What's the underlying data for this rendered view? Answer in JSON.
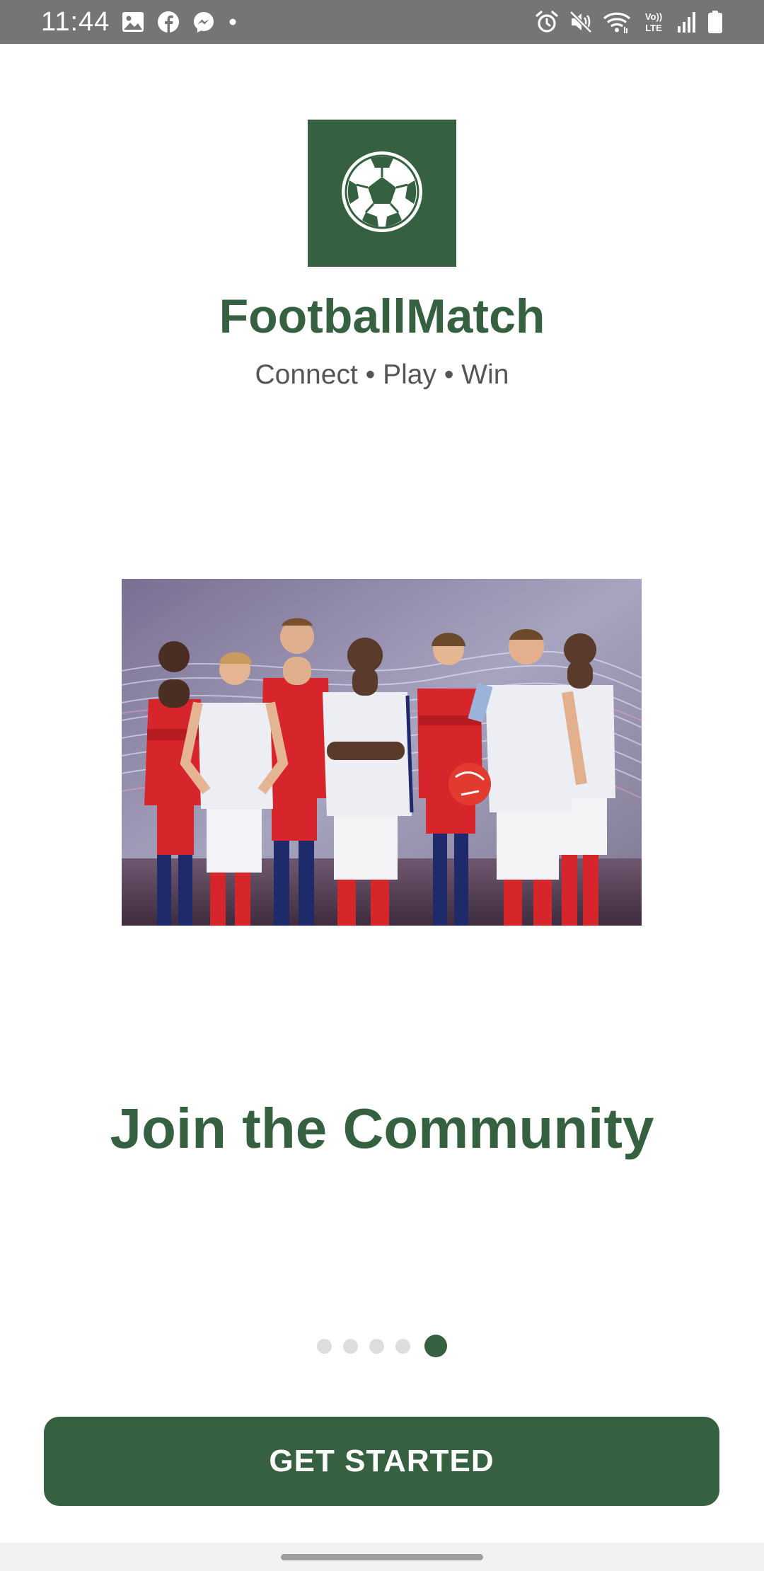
{
  "status_bar": {
    "time": "11:44",
    "left_icons": [
      "gallery-icon",
      "facebook-icon",
      "messenger-icon",
      "dot-icon"
    ],
    "right_icons": [
      "alarm-icon",
      "mute-icon",
      "wifi-icon",
      "volte-icon",
      "signal-icon",
      "battery-icon"
    ],
    "volte_label": "Vo)) LTE"
  },
  "app": {
    "name": "FootballMatch",
    "tagline": "Connect • Play • Win",
    "logo_icon": "soccer-ball-icon"
  },
  "slide": {
    "image_icon": "team-photo",
    "title": "Join the Community"
  },
  "pager": {
    "total": 5,
    "active_index": 4
  },
  "actions": {
    "get_started_label": "GET STARTED"
  },
  "colors": {
    "primary": "#356140",
    "status_bar": "#757575",
    "dot_inactive": "#dddddd",
    "tagline": "#555555"
  }
}
